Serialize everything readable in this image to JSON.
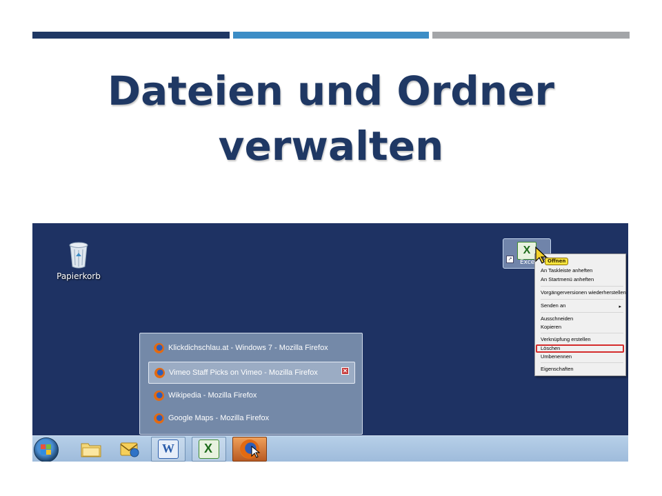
{
  "slide": {
    "title_line1": "Dateien und Ordner",
    "title_line2": "verwalten",
    "accent_colors": [
      "#1f3864",
      "#3c8dc6",
      "#a3a5a8"
    ]
  },
  "desktop": {
    "recycle_bin_label": "Papierkorb",
    "excel_shortcut_label": "Excel",
    "cursor_badge": "Offnen",
    "background_color": "#1e3263"
  },
  "context_menu": {
    "items": [
      "Öffnen",
      "An Taskleiste anheften",
      "An Startmenü anheften",
      "Vorgängerversionen wiederherstellen",
      "Senden an",
      "Ausschneiden",
      "Kopieren",
      "Verknüpfung erstellen",
      "Löschen",
      "Umbenennen",
      "Eigenschaften"
    ],
    "submenu_arrow": "▸",
    "highlighted_item": "Löschen"
  },
  "jump_preview": {
    "items": [
      "Klickdichschlau.at - Windows 7 - Mozilla Firefox",
      "Vimeo Staff Picks on Vimeo - Mozilla Firefox",
      "Wikipedia - Mozilla Firefox",
      "Google Maps - Mozilla Firefox"
    ],
    "active_index": 1,
    "close_glyph": "✕"
  },
  "taskbar": {
    "buttons": [
      "start-orb",
      "explorer-icon",
      "outlook-icon",
      "word-icon",
      "excel-icon",
      "firefox-icon"
    ],
    "word_letter": "W",
    "excel_letter": "X"
  }
}
